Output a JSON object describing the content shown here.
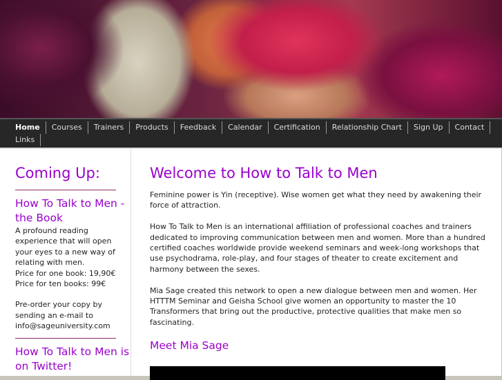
{
  "nav": [
    "Home",
    "Courses",
    "Trainers",
    "Products",
    "Feedback",
    "Calendar",
    "Certification",
    "Relationship Chart",
    "Sign Up",
    "Contact",
    "Links"
  ],
  "sidebar": {
    "title": "Coming Up:",
    "book_title": "How To Talk to Men - the Book",
    "book_desc": "A profound reading experience that will open your eyes to a new way of relating with men.",
    "price_one": "Price for one book: 19,90€",
    "price_ten": "Price for ten books: 99€",
    "preorder": "Pre-order your copy by sending an e-mail to info@sageuniversity.com",
    "twitter_title": "How To Talk to Men is on Twitter!"
  },
  "main": {
    "title": "Welcome to How to Talk to Men",
    "p1": "Feminine power is Yin (receptive). Wise women get what they need by awakening their force of attraction.",
    "p2": "How To Talk to Men is an international affiliation of professional coaches and trainers dedicated to improving communication between men and women. More than a hundred certified coaches worldwide provide weekend seminars and week-long workshops that use psychodrama, role-play, and four stages of theater to create excitement and harmony between the sexes.",
    "p3": "Mia Sage created this network to open a new dialogue between men and women. Her HTTTM Seminar and Geisha School give women an opportunity to master the 10 Transformers that bring out the productive, protective qualities that make men so fascinating.",
    "meet": "Meet Mia Sage"
  }
}
